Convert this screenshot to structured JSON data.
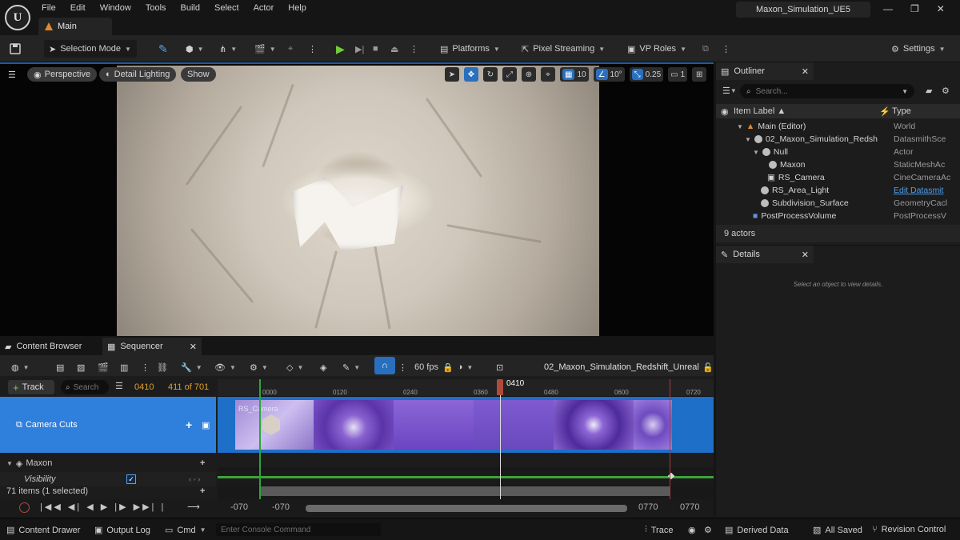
{
  "titlebar": {
    "logo": "U",
    "menu": [
      "File",
      "Edit",
      "Window",
      "Tools",
      "Build",
      "Select",
      "Actor",
      "Help"
    ],
    "tab_label": "Main",
    "project_name": "Maxon_Simulation_UE5",
    "minimize": "—",
    "maximize": "❐",
    "close": "✕"
  },
  "toolbar": {
    "selection_mode": "Selection Mode",
    "platforms": "Platforms",
    "pixel_streaming": "Pixel Streaming",
    "vp_roles": "VP Roles",
    "settings": "Settings"
  },
  "viewport": {
    "perspective": "Perspective",
    "detail_lighting": "Detail Lighting",
    "show": "Show",
    "grid_value": "10",
    "angle_value": "10°",
    "scale_value": "0.25",
    "camera_speed": "1"
  },
  "outliner": {
    "tab_label": "Outliner",
    "search_placeholder": "Search...",
    "col_label": "Item Label ▲",
    "col_type": "Type",
    "rows": [
      {
        "label": "Main (Editor)",
        "type": "World"
      },
      {
        "label": "02_Maxon_Simulation_Redsh",
        "type": "DatasmithSce"
      },
      {
        "label": "Null",
        "type": "Actor"
      },
      {
        "label": "Maxon",
        "type": "StaticMeshAc"
      },
      {
        "label": "RS_Camera",
        "type": "CineCameraAc"
      },
      {
        "label": "RS_Area_Light",
        "type": "Edit Datasmit"
      },
      {
        "label": "Subdivision_Surface",
        "type": "GeometryCacl"
      },
      {
        "label": "PostProcessVolume",
        "type": "PostProcessV"
      }
    ],
    "footer": "9 actors"
  },
  "details": {
    "tab_label": "Details",
    "empty_message": "Select an object to view details."
  },
  "sequencer": {
    "tab_content_browser": "Content Browser",
    "tab_sequencer": "Sequencer",
    "fps": "60 fps",
    "sequence_name": "02_Maxon_Simulation_Redshift_Unreal",
    "track_button": "Track",
    "search_placeholder": "Search",
    "current_frame": "0410",
    "frame_count": "411 of 701",
    "playhead_label": "0410",
    "ticks": [
      "0000",
      "0120",
      "0240",
      "0360",
      "0480",
      "0600",
      "0720"
    ],
    "camera_cuts": "Camera Cuts",
    "clip_label": "RS_Camera",
    "maxon_track": "Maxon",
    "visibility_track": "Visibility",
    "items_selected": "71 items (1 selected)",
    "range_start_1": "-070",
    "range_start_2": "-070",
    "range_end_1": "0770",
    "range_end_2": "0770"
  },
  "statusbar": {
    "content_drawer": "Content Drawer",
    "output_log": "Output Log",
    "cmd": "Cmd",
    "console_placeholder": "Enter Console Command",
    "trace": "Trace",
    "derived_data": "Derived Data",
    "all_saved": "All Saved",
    "revision_control": "Revision Control"
  }
}
